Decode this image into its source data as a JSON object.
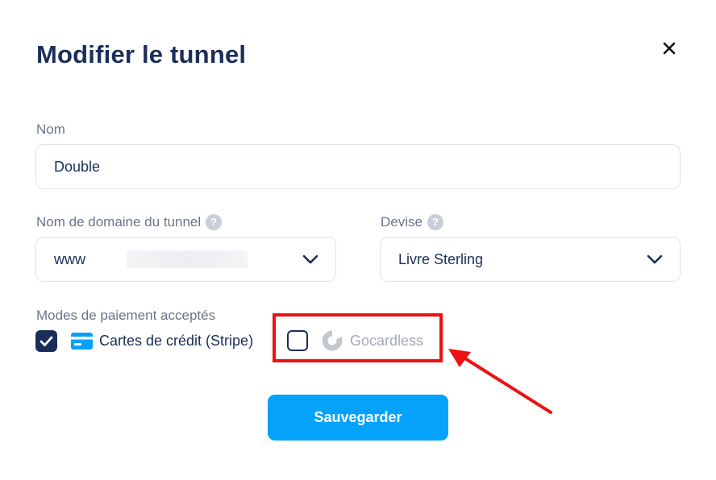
{
  "dialog": {
    "title": "Modifier le tunnel",
    "close_icon": "close-icon"
  },
  "name_field": {
    "label": "Nom",
    "value": "Double"
  },
  "domain_field": {
    "label": "Nom de domaine du tunnel",
    "help_icon": "question-circle-icon",
    "value": "www"
  },
  "currency_field": {
    "label": "Devise",
    "help_icon": "question-circle-icon",
    "value": "Livre Sterling"
  },
  "payment": {
    "label": "Modes de paiement acceptés",
    "methods": [
      {
        "label": "Cartes de crédit (Stripe)",
        "checked": true,
        "icon": "credit-card-icon"
      },
      {
        "label": "Gocardless",
        "checked": false,
        "icon": "gocardless-icon"
      }
    ]
  },
  "annotation": {
    "highlight_color": "#ee1111"
  },
  "actions": {
    "save_label": "Sauvegarder"
  },
  "colors": {
    "primary_text": "#1b2e5a",
    "accent": "#05a2fb",
    "muted": "#6b7487"
  }
}
